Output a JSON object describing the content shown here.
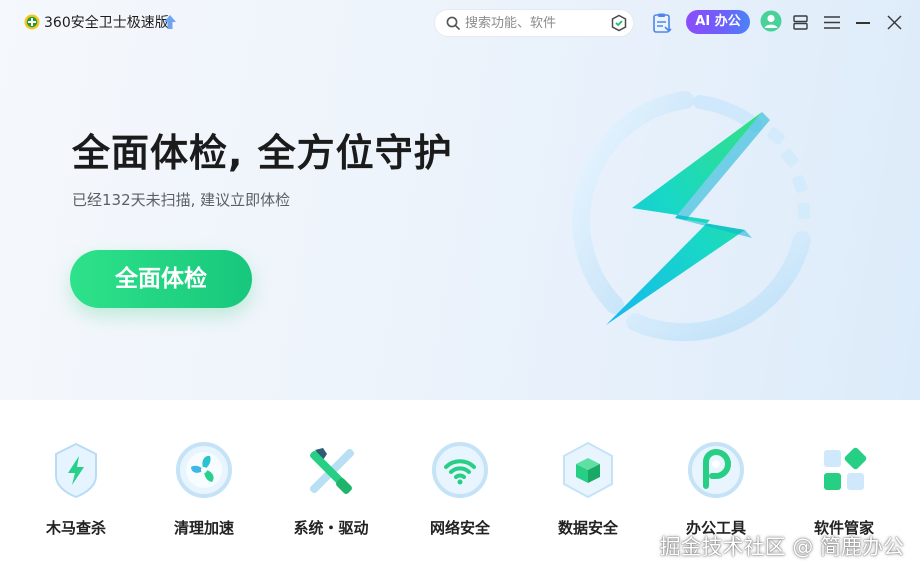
{
  "window": {
    "app_title": "360安全卫士极速版",
    "search_placeholder": "搜索功能、软件",
    "ai_button_label": "AI 办公"
  },
  "hero": {
    "headline": "全面体检, 全方位守护",
    "subline": "已经132天未扫描, 建议立即体检",
    "scan_button_label": "全面体检"
  },
  "tools": [
    {
      "label": "木马查杀",
      "icon": "trojan-shield-icon"
    },
    {
      "label": "清理加速",
      "icon": "cleanup-fan-icon"
    },
    {
      "label": "系统・驱动",
      "icon": "system-tools-icon"
    },
    {
      "label": "网络安全",
      "icon": "wifi-icon"
    },
    {
      "label": "数据安全",
      "icon": "data-cube-icon"
    },
    {
      "label": "办公工具",
      "icon": "office-p-icon"
    },
    {
      "label": "软件管家",
      "icon": "software-grid-icon"
    }
  ],
  "watermark": "掘金技术社区 @ 简鹿办公",
  "colors": {
    "accent_green": "#1fcf7e",
    "ai_purple": "#7a55fb",
    "ai_blue": "#4b83f7",
    "lightning_cyan": "#19d6e8"
  }
}
